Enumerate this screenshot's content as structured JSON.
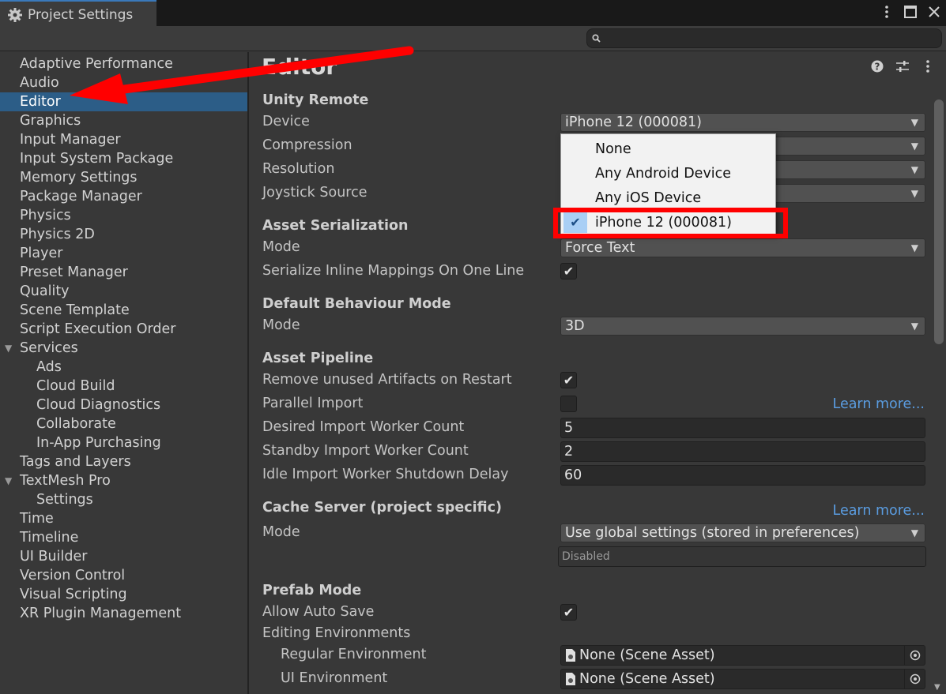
{
  "window": {
    "tab_title": "Project Settings",
    "tab_icon": "gear-icon",
    "buttons": [
      "kebab-menu-icon",
      "maximize-icon",
      "close-icon"
    ]
  },
  "search": {
    "placeholder": "",
    "value": ""
  },
  "sidebar": {
    "items": [
      {
        "label": "Adaptive Performance"
      },
      {
        "label": "Audio"
      },
      {
        "label": "Editor",
        "selected": true
      },
      {
        "label": "Graphics"
      },
      {
        "label": "Input Manager"
      },
      {
        "label": "Input System Package"
      },
      {
        "label": "Memory Settings"
      },
      {
        "label": "Package Manager"
      },
      {
        "label": "Physics"
      },
      {
        "label": "Physics 2D"
      },
      {
        "label": "Player"
      },
      {
        "label": "Preset Manager"
      },
      {
        "label": "Quality"
      },
      {
        "label": "Scene Template"
      },
      {
        "label": "Script Execution Order"
      },
      {
        "label": "Services",
        "expanded": true
      },
      {
        "label": "Ads",
        "child": true
      },
      {
        "label": "Cloud Build",
        "child": true
      },
      {
        "label": "Cloud Diagnostics",
        "child": true
      },
      {
        "label": "Collaborate",
        "child": true
      },
      {
        "label": "In-App Purchasing",
        "child": true
      },
      {
        "label": "Tags and Layers"
      },
      {
        "label": "TextMesh Pro",
        "expanded": true
      },
      {
        "label": "Settings",
        "child": true
      },
      {
        "label": "Time"
      },
      {
        "label": "Timeline"
      },
      {
        "label": "UI Builder"
      },
      {
        "label": "Version Control"
      },
      {
        "label": "Visual Scripting"
      },
      {
        "label": "XR Plugin Management"
      }
    ]
  },
  "main": {
    "title": "Editor",
    "unity_remote": {
      "header": "Unity Remote",
      "device_label": "Device",
      "device_value": "iPhone 12 (000081)",
      "compression_label": "Compression",
      "resolution_label": "Resolution",
      "joystick_label": "Joystick Source"
    },
    "asset_serialization": {
      "header": "Asset Serialization",
      "mode_label": "Mode",
      "mode_value": "Force Text",
      "inline_label": "Serialize Inline Mappings On One Line",
      "inline_checked": true
    },
    "default_behaviour": {
      "header": "Default Behaviour Mode",
      "mode_label": "Mode",
      "mode_value": "3D"
    },
    "asset_pipeline": {
      "header": "Asset Pipeline",
      "remove_label": "Remove unused Artifacts on Restart",
      "remove_checked": true,
      "parallel_label": "Parallel Import",
      "parallel_checked": false,
      "learn_more": "Learn more...",
      "desired_label": "Desired Import Worker Count",
      "desired_value": "5",
      "standby_label": "Standby Import Worker Count",
      "standby_value": "2",
      "idle_label": "Idle Import Worker Shutdown Delay",
      "idle_value": "60"
    },
    "cache_server": {
      "header": "Cache Server (project specific)",
      "learn_more": "Learn more...",
      "mode_label": "Mode",
      "mode_value": "Use global settings (stored in preferences)",
      "status_value": "Disabled"
    },
    "prefab_mode": {
      "header": "Prefab Mode",
      "autosave_label": "Allow Auto Save",
      "autosave_checked": true,
      "editing_env_label": "Editing Environments",
      "regular_label": "Regular Environment",
      "regular_value": "None (Scene Asset)",
      "ui_label": "UI Environment",
      "ui_value": "None (Scene Asset)"
    }
  },
  "popup": {
    "items": [
      {
        "label": "None"
      },
      {
        "label": "Any Android Device"
      },
      {
        "label": "Any iOS Device"
      },
      {
        "label": "iPhone 12 (000081)",
        "checked": true
      }
    ]
  },
  "colors": {
    "selection": "#2c5d87",
    "link": "#5a9ce0",
    "annotation": "#ff0000"
  }
}
